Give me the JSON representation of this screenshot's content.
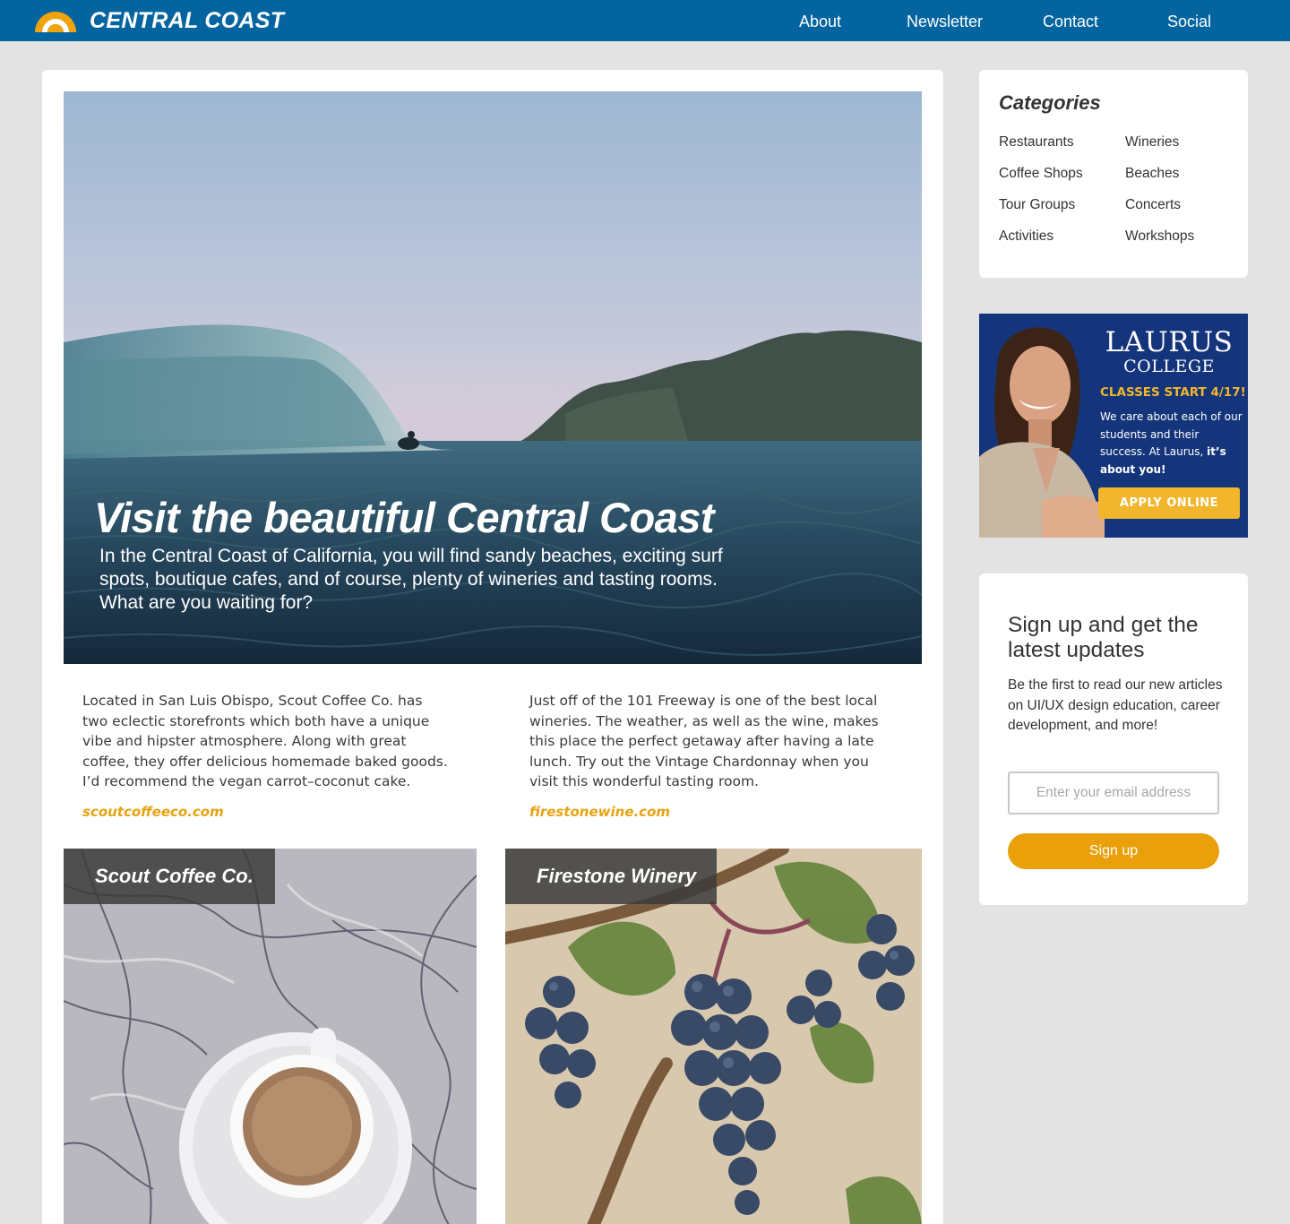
{
  "header": {
    "brand": "CENTRAL COAST",
    "logo_icon": "rainbow-sun-icon",
    "nav": [
      "About",
      "Newsletter",
      "Contact",
      "Social"
    ]
  },
  "hero": {
    "title": "Visit the beautiful Central Coast",
    "subtitle": "In the Central Coast of California, you will find sandy beaches, exciting surf spots, boutique cafes, and of course, plenty of wineries and tasting rooms. What are you waiting for?"
  },
  "articles": [
    {
      "text": "Located in San Luis Obispo, Scout Coffee Co. has two eclectic storefronts which both have a unique vibe and hipster atmosphere. Along with great coffee, they offer delicious homemade baked goods. I’d recommend the vegan carrot–coconut cake.",
      "link": "scoutcoffeeco.com",
      "label": "Scout Coffee Co."
    },
    {
      "text": "Just off of the 101 Freeway is one of the best local wineries. The weather, as well as the wine, makes this place the perfect getaway after having a late lunch. Try out the Vintage Chardonnay when you visit this wonderful tasting room.",
      "link": "firestonewine.com",
      "label": "Firestone Winery"
    }
  ],
  "categories": {
    "title": "Categories",
    "left": [
      "Restaurants",
      "Coffee Shops",
      "Tour Groups",
      "Activities"
    ],
    "right": [
      "Wineries",
      "Beaches",
      "Concerts",
      "Workshops"
    ]
  },
  "ad": {
    "name_line1": "LAURUS",
    "name_line2": "COLLEGE",
    "classes": "CLASSES START 4/17!",
    "text_plain": "We care about each of our students and their success. At Laurus, ",
    "text_bold": "it’s about you!",
    "button": "APPLY ONLINE"
  },
  "signup": {
    "title": "Sign up and get the latest updates",
    "text": "Be the first to read our new articles on UI/UX design education, career development, and more!",
    "placeholder": "Enter your email address",
    "button": "Sign up"
  },
  "colors": {
    "header_bg": "#04649f",
    "accent_orange": "#e9a00a",
    "link_gold": "#e6a313",
    "ad_bg": "#14357b",
    "ad_yellow": "#f1b62c"
  }
}
